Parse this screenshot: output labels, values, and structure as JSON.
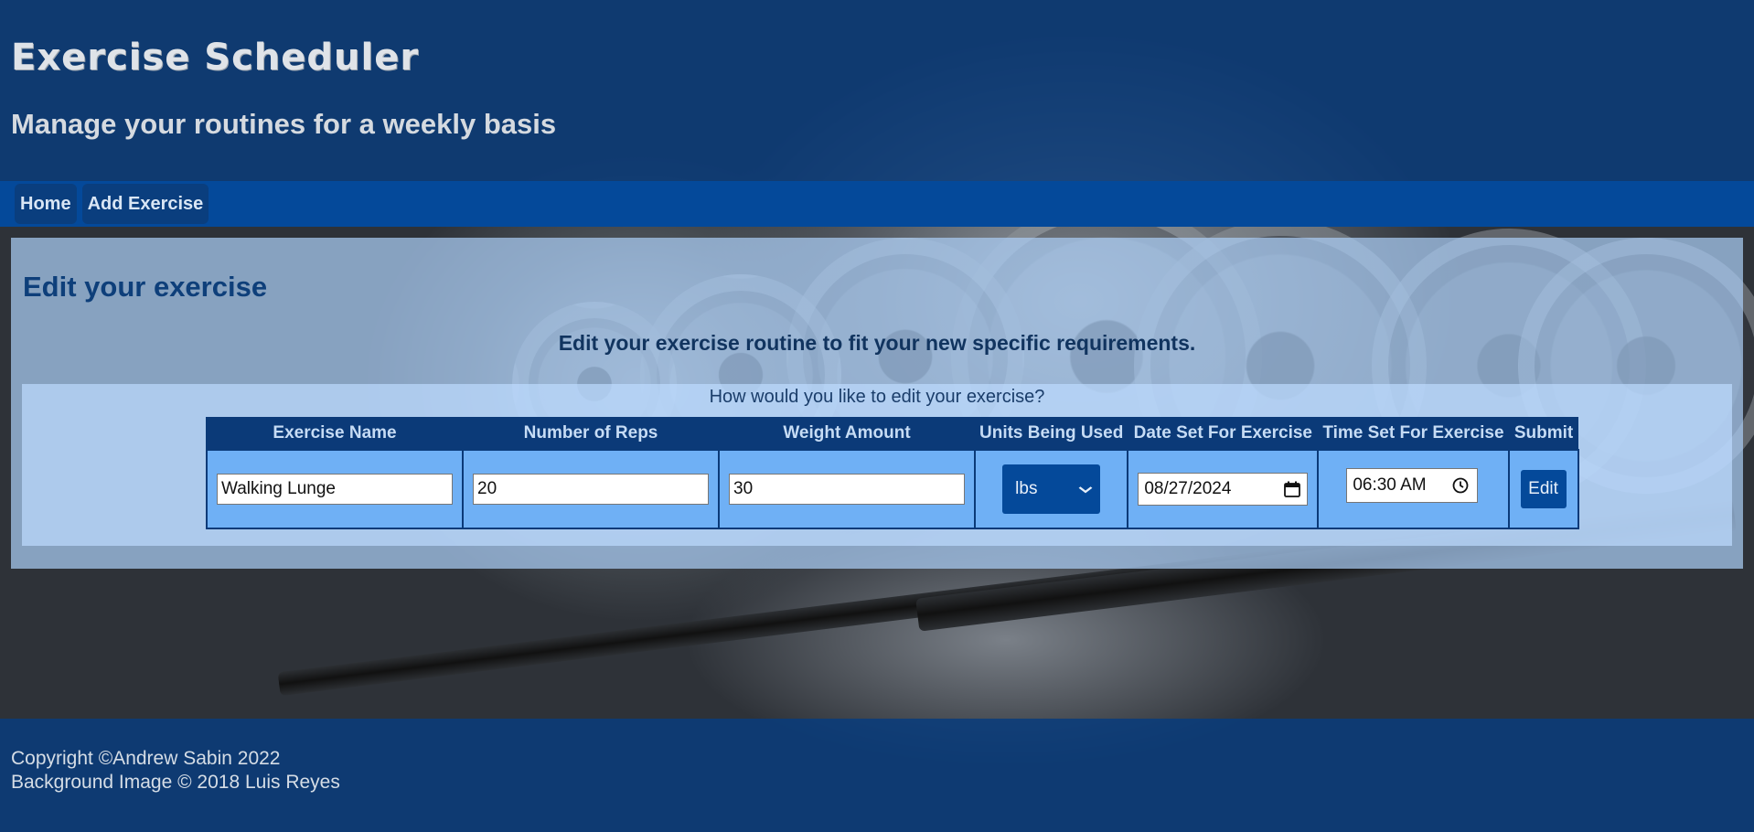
{
  "header": {
    "title": "Exercise Scheduler",
    "subtitle": "Manage your routines for a weekly basis"
  },
  "nav": {
    "items": [
      {
        "label": "Home"
      },
      {
        "label": "Add Exercise"
      }
    ]
  },
  "main": {
    "heading": "Edit your exercise",
    "intro": "Edit your exercise routine to fit your new specific requirements.",
    "form_caption": "How would you like to edit your exercise?",
    "columns": [
      "Exercise Name",
      "Number of Reps",
      "Weight Amount",
      "Units Being Used",
      "Date Set For Exercise",
      "Time Set For Exercise",
      "Submit"
    ],
    "values": {
      "name": "Walking Lunge",
      "reps": "20",
      "weight": "30",
      "units": "lbs",
      "date": "08/27/2024",
      "time": "06:30 AM"
    },
    "submit_label": "Edit"
  },
  "footer": {
    "copyright": "Copyright ©Andrew Sabin 2022",
    "image_credit": "Background Image © 2018 Luis Reyes"
  },
  "icons": {
    "units_dropdown": "chevron-down-icon",
    "date_picker": "calendar-icon",
    "time_picker": "clock-icon"
  },
  "colors": {
    "header_blue": "#083c7d",
    "nav_blue": "#04499a",
    "table_header": "#0b3a78",
    "table_cell": "#6fb0f5"
  }
}
